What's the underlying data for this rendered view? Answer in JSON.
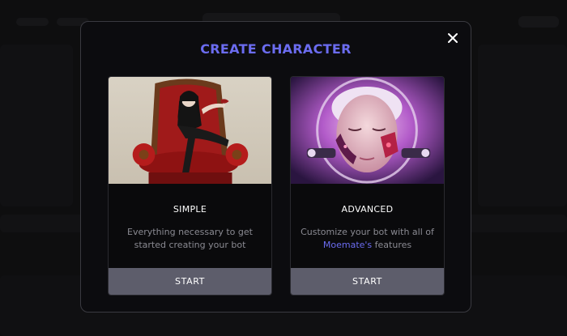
{
  "modal": {
    "title": "CREATE CHARACTER",
    "close_icon": "close-icon",
    "accent_color": "#6b6cf0"
  },
  "cards": [
    {
      "id": "simple",
      "title": "SIMPLE",
      "description": "Everything necessary to get started creating your bot",
      "button": "START"
    },
    {
      "id": "advanced",
      "title": "ADVANCED",
      "description_prefix": "Customize your bot with all of",
      "brand": "Moemate's",
      "description_suffix": "features",
      "button": "START"
    }
  ]
}
